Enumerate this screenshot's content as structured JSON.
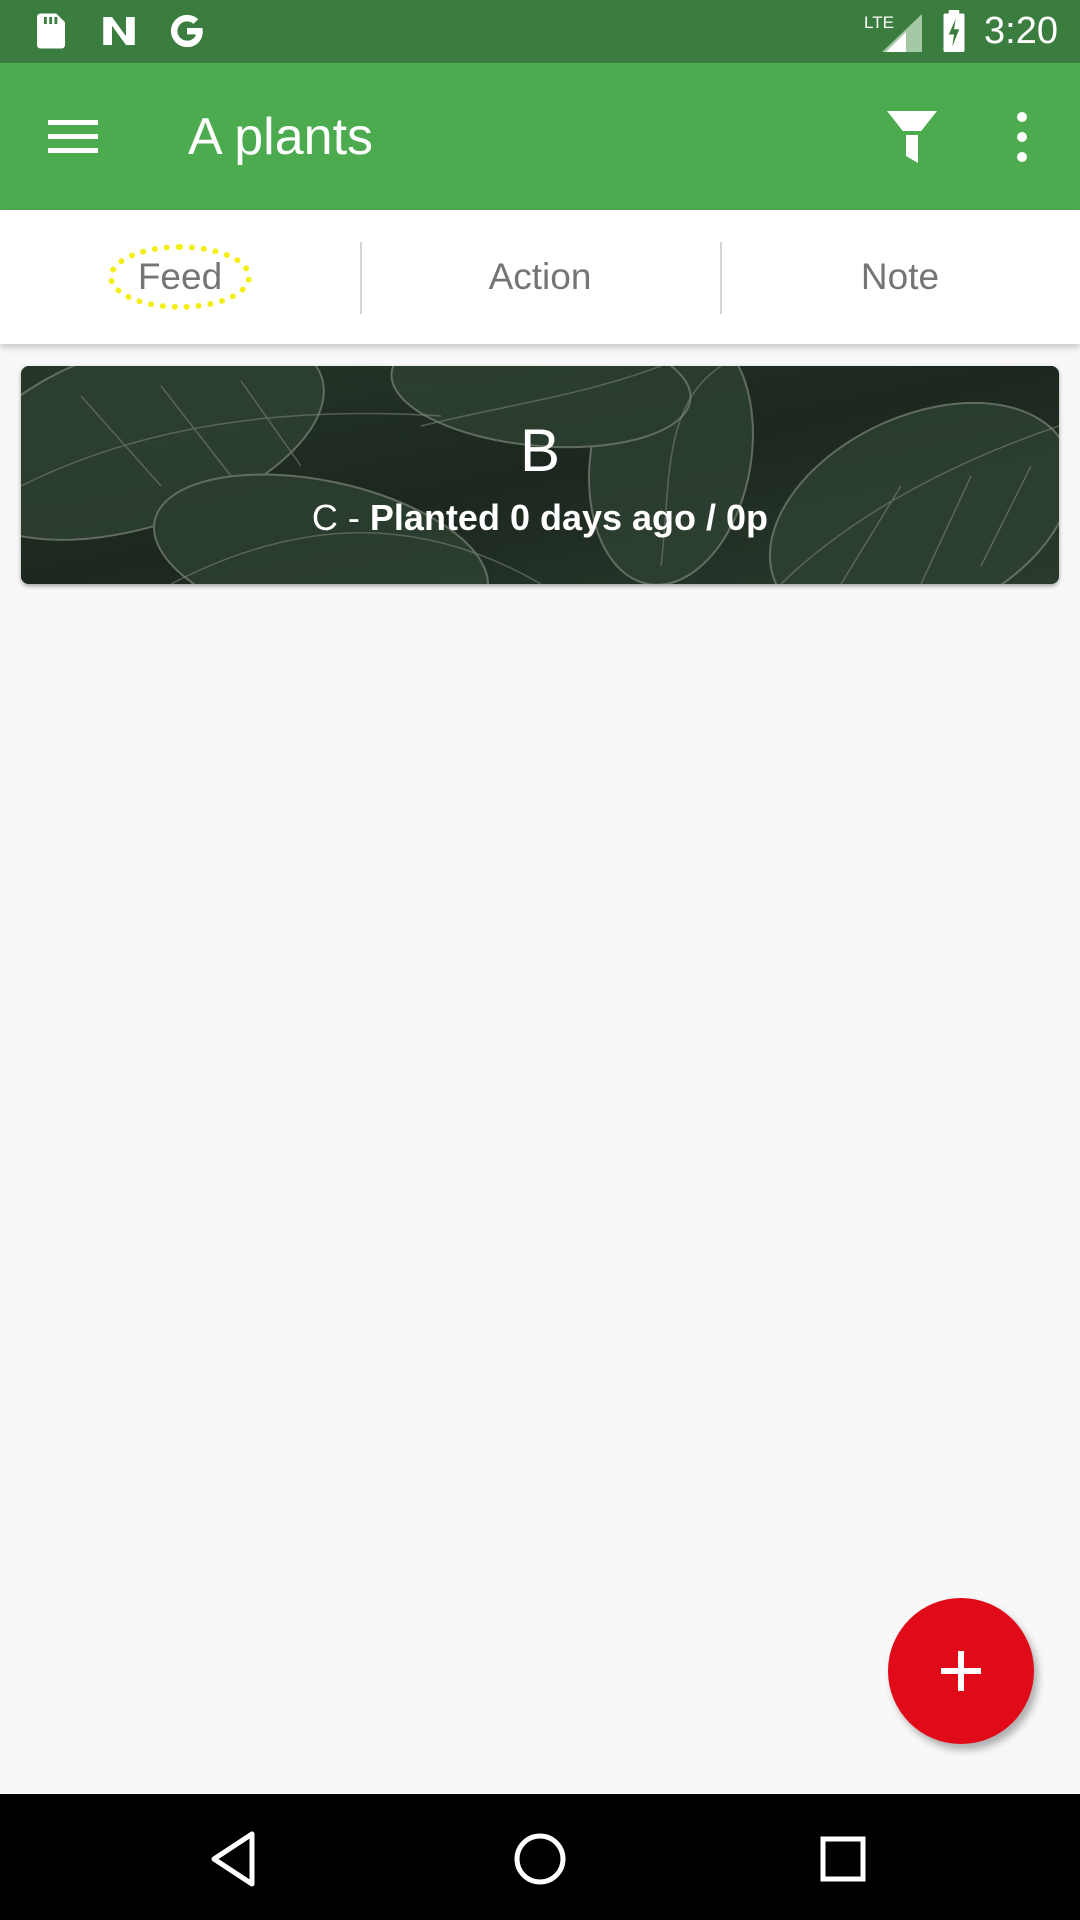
{
  "status_bar": {
    "time": "3:20",
    "network_label": "LTE",
    "icons": [
      "sd-card-icon",
      "n-app-icon",
      "google-icon",
      "lte-signal-icon",
      "battery-charging-icon"
    ]
  },
  "app_bar": {
    "title": "A plants",
    "icons": [
      "menu-icon",
      "filter-icon",
      "more-vert-icon"
    ]
  },
  "tabs": [
    {
      "label": "Feed",
      "focused": true
    },
    {
      "label": "Action",
      "focused": false
    },
    {
      "label": "Note",
      "focused": false
    }
  ],
  "plants": [
    {
      "name": "B",
      "subtitle_prefix": "C - ",
      "subtitle_bold": "Planted 0 days ago / 0p"
    }
  ],
  "fab": {
    "icon": "add-icon"
  },
  "nav_bar": {
    "icons": [
      "back-icon",
      "home-icon",
      "recents-icon"
    ]
  },
  "colors": {
    "status_bar": "#3b7d3e",
    "app_bar": "#4caa4f",
    "fab": "#e10a19",
    "tab_text": "#757575",
    "focus_ring": "#f3ef16"
  }
}
